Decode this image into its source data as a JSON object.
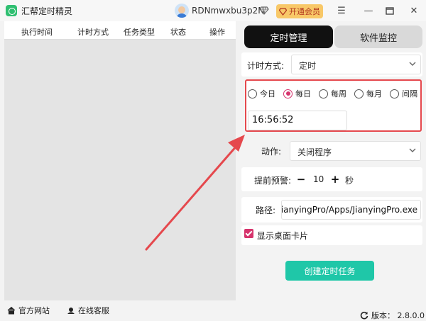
{
  "window": {
    "title": "汇帮定时精灵",
    "username": "RDNmwxbu3p2N",
    "vip_label": "开通会员",
    "menu_icon": "menu-icon",
    "min_icon": "minimize-icon",
    "max_icon": "maximize-icon",
    "close_icon": "close-icon"
  },
  "task_table": {
    "columns": [
      "执行时间",
      "计时方式",
      "任务类型",
      "状态",
      "操作"
    ]
  },
  "tabs": [
    {
      "label": "定时管理",
      "active": true
    },
    {
      "label": "软件监控",
      "active": false
    }
  ],
  "form": {
    "timing_label": "计时方式:",
    "timing_value": "定时",
    "frequency_options": [
      "今日",
      "每日",
      "每周",
      "每月",
      "间隔"
    ],
    "frequency_selected": "每日",
    "time_value": "16:56:52",
    "action_label": "动作:",
    "action_value": "关闭程序",
    "warning_label": "提前预警:",
    "warning_value": "10",
    "warning_unit": "秒",
    "path_label": "路径:",
    "path_value": "l/JianyingPro/Apps/JianyingPro.exe",
    "show_card_label": "显示桌面卡片",
    "show_card_checked": true,
    "create_button": "创建定时任务"
  },
  "footer": {
    "website": "官方网站",
    "support": "在线客服",
    "version": "版本： 2.8.0.0"
  },
  "colors": {
    "accent": "#d6336c",
    "primary_button": "#1fc7a8",
    "highlight_border": "#e5484d",
    "vip_bg": "#f8c868"
  }
}
